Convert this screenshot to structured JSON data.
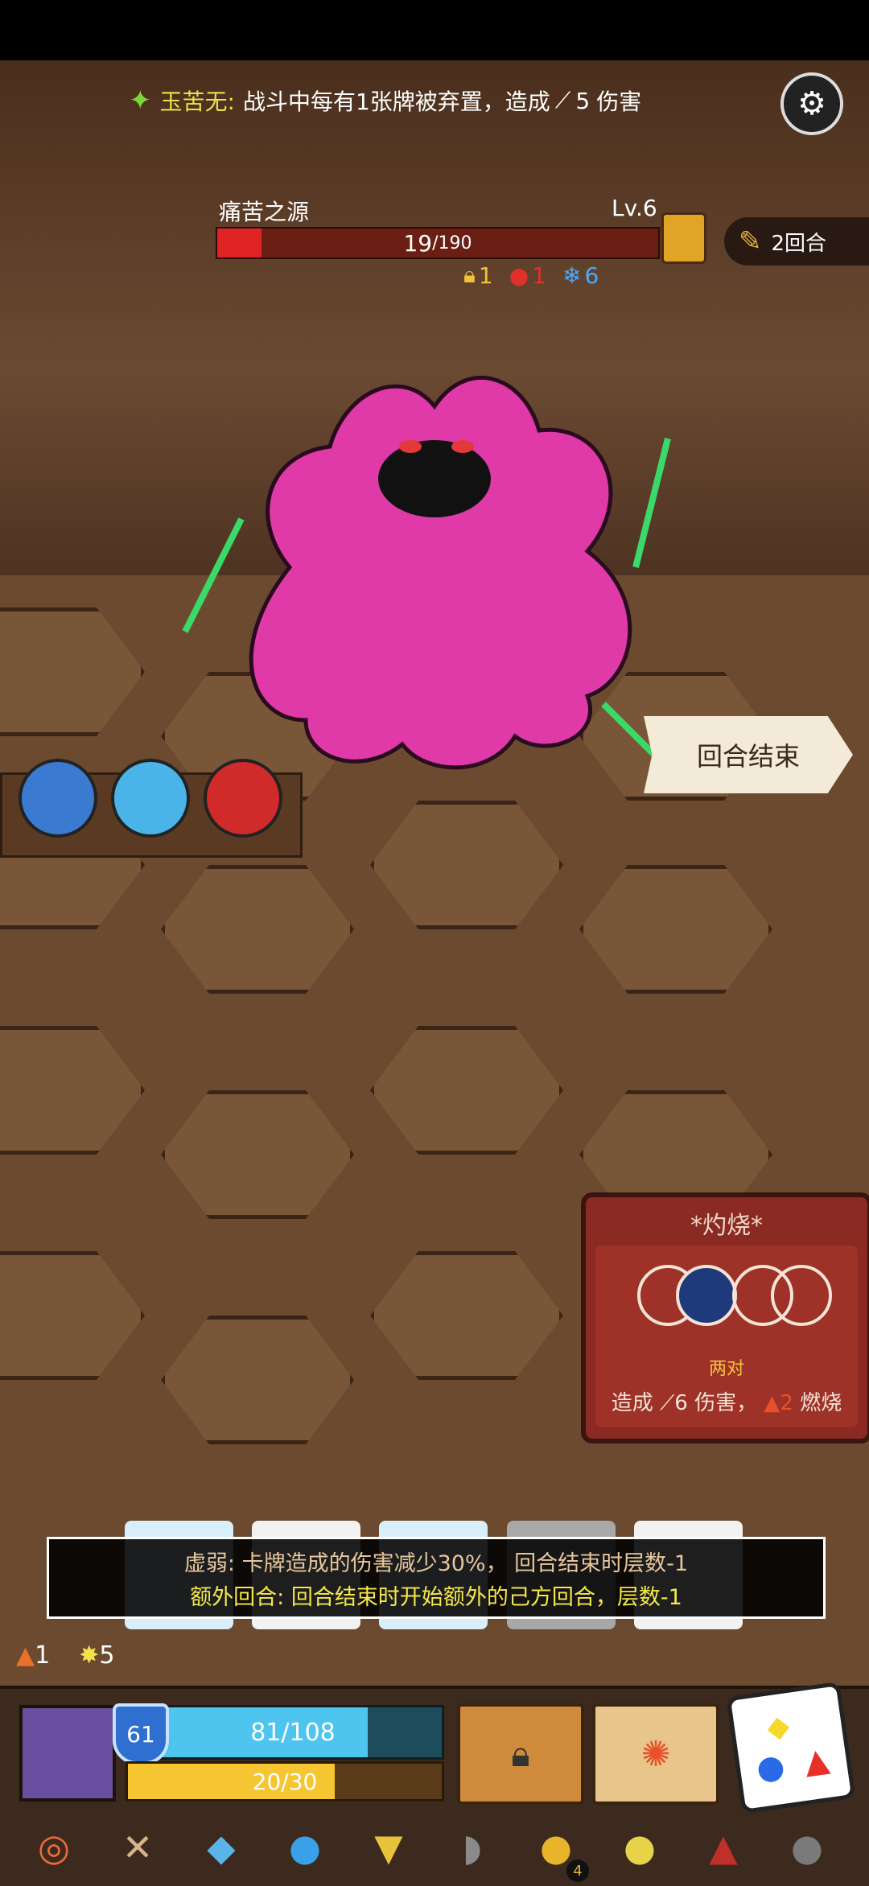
{
  "top_buff": {
    "icon": "bamboo-leaf-icon",
    "name": "玉苦无:",
    "text": "战斗中每有1张牌被弃置，造成",
    "damage": "5",
    "suffix": "伤害"
  },
  "boss": {
    "name": "痛苦之源",
    "level": "Lv.6",
    "hp_current": "19",
    "hp_max": "/190",
    "hp_fraction": 0.1,
    "status": [
      {
        "icon": "lock-icon",
        "value": "1",
        "color": "#f0c23a"
      },
      {
        "icon": "blood-drop-icon",
        "value": "1",
        "color": "#e0302a"
      },
      {
        "icon": "snowflake-icon",
        "value": "6",
        "color": "#4aa8ff"
      }
    ]
  },
  "round": {
    "label": "2回合"
  },
  "end_turn": {
    "label": "回合结束"
  },
  "burn_card": {
    "title": "*灼烧*",
    "pairs_label": "两对",
    "desc_prefix": "造成",
    "damage": "6",
    "desc_mid": "伤害，",
    "burn_value": "2",
    "burn_label": "燃烧"
  },
  "tooltip": {
    "line1": "虚弱: 卡牌造成的伤害减少30%， 回合结束时层数-1",
    "line2": "额外回合: 回合结束时开始额外的己方回合，层数-1"
  },
  "counters": [
    {
      "icon": "fire-icon",
      "value": "1",
      "color": "#e8702a"
    },
    {
      "icon": "star-burst-icon",
      "value": "5",
      "color": "#f5e04a"
    }
  ],
  "player": {
    "shield": "61",
    "hp": "81/108",
    "hp_fraction": 0.75,
    "energy": "20/30",
    "energy_fraction": 0.66
  },
  "relics": [
    {
      "name": "shield-ring-icon",
      "glyph": "◎",
      "color": "#e86a3a"
    },
    {
      "name": "horn-icon",
      "glyph": "✕",
      "color": "#d9b48a"
    },
    {
      "name": "ice-cube-icon",
      "glyph": "◆",
      "color": "#5ab4e8"
    },
    {
      "name": "water-drop-icon",
      "glyph": "●",
      "color": "#3aa0e8"
    },
    {
      "name": "amulet-icon",
      "glyph": "▼",
      "color": "#e8c23a"
    },
    {
      "name": "helmet-icon",
      "glyph": "◗",
      "color": "#8a8a8a"
    },
    {
      "name": "gold-pouch-icon",
      "glyph": "●",
      "color": "#e8b42a",
      "badge": "4"
    },
    {
      "name": "jar-icon",
      "glyph": "●",
      "color": "#e8d24a"
    },
    {
      "name": "red-hood-icon",
      "glyph": "▲",
      "color": "#c0302a"
    },
    {
      "name": "stone-icon",
      "glyph": "●",
      "color": "#7a7a7a"
    }
  ]
}
